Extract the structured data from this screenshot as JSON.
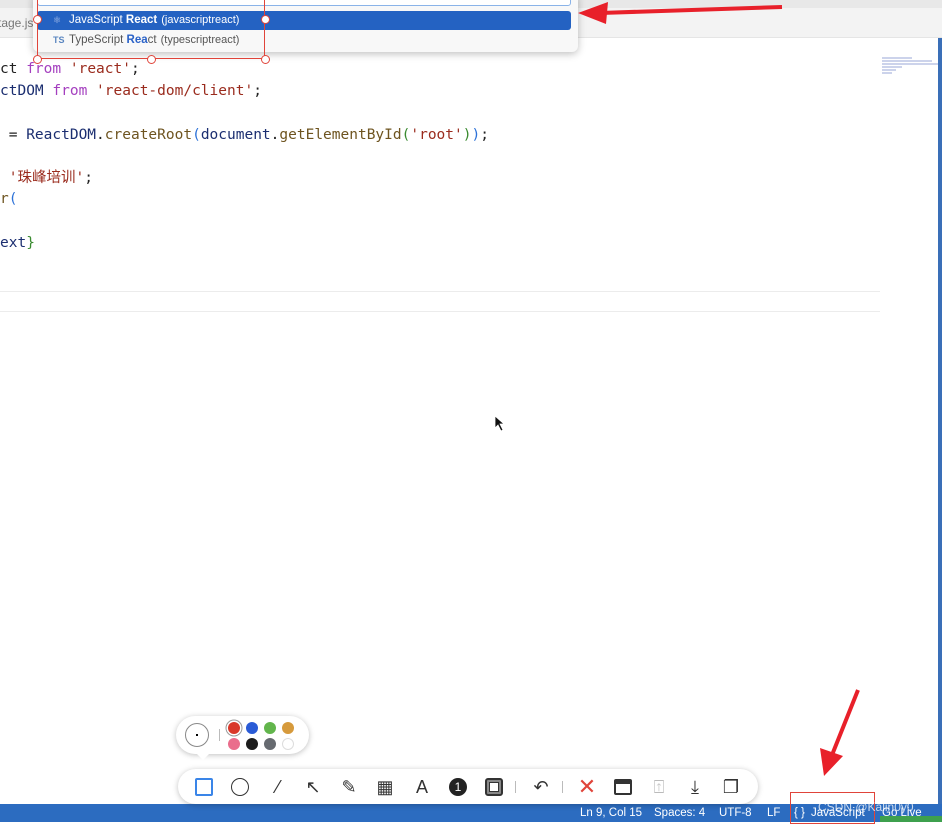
{
  "tab": {
    "label": "tage.js"
  },
  "language_picker": {
    "items": [
      {
        "icon": "react-icon",
        "label_pre": "JavaScript ",
        "label_hl": "React",
        "label_post": "",
        "desc": "(javascriptreact)",
        "selected": true
      },
      {
        "icon": "TS",
        "label_pre": "TypeScript ",
        "label_hl": "Rea",
        "label_post": "ct",
        "desc": "(typescriptreact)",
        "selected": false
      }
    ]
  },
  "code": {
    "l1": {
      "a": "ct ",
      "b": "from",
      "c": " ",
      "d": "'react'",
      "e": ";"
    },
    "l2": {
      "a": "ctDOM ",
      "b": "from",
      "c": " ",
      "d": "'react-dom/client'",
      "e": ";"
    },
    "l3": {
      "a": " = ",
      "b": "ReactDOM",
      "c": ".",
      "d": "createRoot",
      "e": "(",
      "f": "document",
      "g": ".",
      "h": "getElementById",
      "i": "(",
      "j": "'root'",
      "k": ")",
      "l": ")",
      "m": ";"
    },
    "l4": {
      "a": " ",
      "b": "'珠峰培训'",
      "c": ";"
    },
    "l5": {
      "a": "r",
      "b": "("
    },
    "l6": {
      "a": "ext",
      "b": "}"
    }
  },
  "status_bar": {
    "position": "Ln 9, Col 15",
    "spaces": "Spaces: 4",
    "encoding": "UTF-8",
    "eol": "LF",
    "language_icon": "{ }",
    "language": "JavaScript",
    "golive": "Go Live",
    "watermark": "CSDN @Kalin0y0"
  },
  "annotation_toolbar": {
    "tools": [
      "rectangle",
      "ellipse",
      "line",
      "arrow",
      "pencil",
      "mosaic",
      "text",
      "number",
      "frame",
      "undo",
      "close",
      "window-capture",
      "pin",
      "download",
      "copy"
    ],
    "selected_tool": "rectangle",
    "colors": [
      "#d9382a",
      "#2a5bd6",
      "#62b54c",
      "#d69a3c",
      "#ea6d8c",
      "#1c1c1c",
      "#666a70",
      "#ffffff"
    ],
    "selected_color": "#d9382a"
  },
  "colors": {
    "accent": "#2462c2",
    "status_bar": "#2c6cc0",
    "annotation": "#e0443a"
  }
}
